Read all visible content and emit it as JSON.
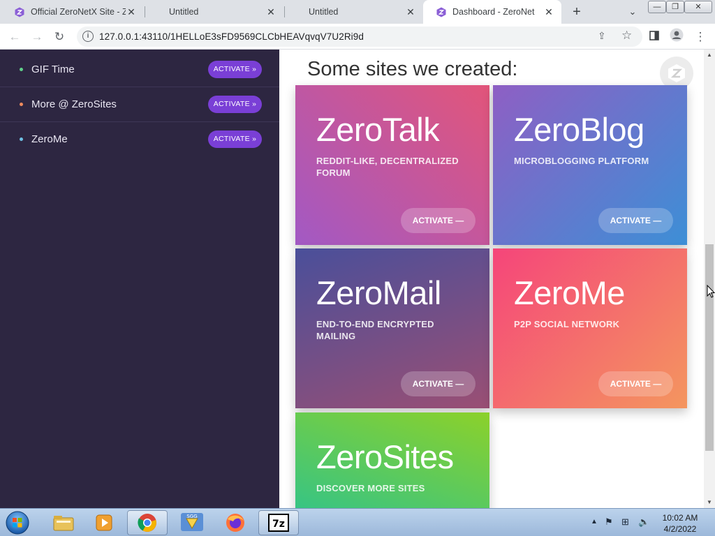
{
  "browser": {
    "tabs": [
      {
        "title": "Official ZeroNetX Site - Z",
        "active": false
      },
      {
        "title": "Untitled",
        "active": false
      },
      {
        "title": "Untitled",
        "active": false
      },
      {
        "title": "Dashboard - ZeroNet",
        "active": true
      }
    ],
    "url": "127.0.0.1:43110/1HELLoE3sFD9569CLCbHEAVqvqV7U2Ri9d"
  },
  "sidebar": {
    "items": [
      {
        "label": "GIF Time",
        "button": "ACTIVATE »",
        "dot_color": "#5fd08a"
      },
      {
        "label": "More @ ZeroSites",
        "button": "ACTIVATE »",
        "dot_color": "#f08a5d"
      },
      {
        "label": "ZeroMe",
        "button": "ACTIVATE »",
        "dot_color": "#6ec1e4"
      }
    ]
  },
  "main": {
    "section_title": "Some sites we created:",
    "cards": [
      {
        "title": "ZeroTalk",
        "desc": "REDDIT-LIKE, DECENTRALIZED FORUM",
        "button": "ACTIVATE —"
      },
      {
        "title": "ZeroBlog",
        "desc": "MICROBLOGGING PLATFORM",
        "button": "ACTIVATE —"
      },
      {
        "title": "ZeroMail",
        "desc": "END-TO-END ENCRYPTED MAILING",
        "button": "ACTIVATE —"
      },
      {
        "title": "ZeroMe",
        "desc": "P2P SOCIAL NETWORK",
        "button": "ACTIVATE —"
      },
      {
        "title": "ZeroSites",
        "desc": "DISCOVER MORE SITES",
        "button": ""
      }
    ]
  },
  "taskbar": {
    "time": "10:02 AM",
    "date": "4/2/2022"
  },
  "colors": {
    "sidebar_bg": "#2d2641",
    "activate_purple": "#7a3fd6",
    "zerotalk": [
      "#a259c4",
      "#e2557a"
    ],
    "zeroblog": [
      "#8e5fc4",
      "#3d8fd6"
    ],
    "zeromail": [
      "#4a4f9a",
      "#9a4f74"
    ],
    "zerome": [
      "#f5457a",
      "#f4965f"
    ],
    "zerosites": [
      "#8cd12a",
      "#2fc38c"
    ]
  }
}
